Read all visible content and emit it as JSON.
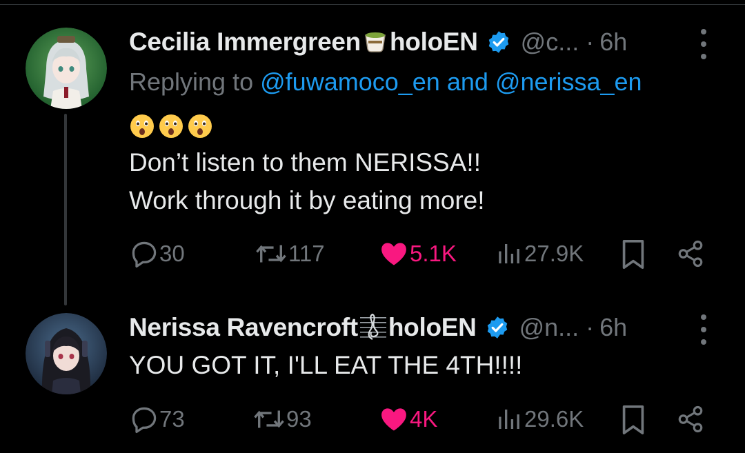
{
  "tweets": [
    {
      "display_name": "Cecilia Immergreen",
      "name_emoji": "🍵",
      "name_suffix": "holoEN",
      "handle": "@c...",
      "separator": "·",
      "time": "6h",
      "replying_label": "Replying to",
      "replying_mention1": "@fuwamoco_en",
      "replying_and": "and",
      "replying_mention2": "@nerissa_en",
      "emoji_row": "😮😮😮",
      "body_line1": "Don’t listen to them NERISSA!!",
      "body_line2": "Work through it by eating more!",
      "replies": "30",
      "reposts": "117",
      "likes": "5.1K",
      "views": "27.9K"
    },
    {
      "display_name": "Nerissa Ravencroft",
      "name_emoji": "🎼",
      "name_suffix": "holoEN",
      "handle": "@n...",
      "separator": "·",
      "time": "6h",
      "body_line1": "YOU GOT IT, I'LL EAT THE 4TH!!!!",
      "replies": "73",
      "reposts": "93",
      "likes": "4K",
      "views": "29.6K"
    }
  ],
  "colors": {
    "background": "#000000",
    "text": "#e7e9ea",
    "muted": "#71767b",
    "link": "#1d9bf0",
    "like": "#f91880",
    "verified": "#1d9bf0"
  },
  "icons": [
    "reply-icon",
    "repost-icon",
    "heart-filled-icon",
    "views-icon",
    "bookmark-icon",
    "share-icon",
    "verified-badge-icon",
    "more-options-icon",
    "astonished-face-icon",
    "tea-cup-icon",
    "musical-score-icon"
  ]
}
